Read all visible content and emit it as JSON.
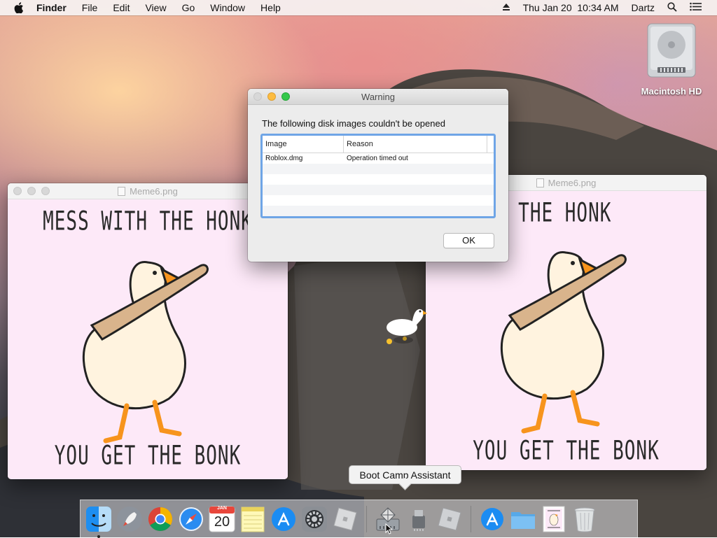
{
  "menubar": {
    "app_name": "Finder",
    "menus": [
      "File",
      "Edit",
      "View",
      "Go",
      "Window",
      "Help"
    ],
    "clock": "Thu Jan 20  10:34 AM",
    "user": "Dartz",
    "icons": [
      "apple-icon",
      "eject-icon",
      "spotlight-search-icon",
      "notification-center-icon"
    ]
  },
  "desktop": {
    "drive_label": "Macintosh HD"
  },
  "meme_window_left": {
    "title": "Meme6.png",
    "top_text": "MESS WITH THE HONK",
    "bottom_text": "YOU GET THE BONK"
  },
  "meme_window_right": {
    "title": "Meme6.png",
    "top_text": "S WITH THE HONK",
    "bottom_text": "YOU GET THE BONK"
  },
  "warning_dialog": {
    "title": "Warning",
    "message": "The following disk images couldn't be opened",
    "columns": [
      "Image",
      "Reason"
    ],
    "rows": [
      {
        "image": "Roblox.dmg",
        "reason": "Operation timed out"
      }
    ],
    "ok_label": "OK"
  },
  "tooltip": {
    "text": "Boot Camp Assistant"
  },
  "dock": {
    "calendar_month": "JAN",
    "calendar_day": "20",
    "items": [
      "finder-icon",
      "launchpad-icon",
      "chrome-icon",
      "safari-icon",
      "calendar-icon",
      "notes-icon",
      "app-store-icon",
      "system-preferences-icon",
      "roblox-icon",
      "boot-camp-assistant-icon",
      "usb-installer-icon",
      "roblox-studio-icon",
      "app-store-folder-icon",
      "folder-icon",
      "meme-image-icon",
      "trash-icon"
    ]
  },
  "colors": {
    "meme_background": "#fde9f8",
    "dialog_focus_ring": "#6fa5e6",
    "goose_beak": "#f7941d",
    "goose_body": "#fff3df"
  }
}
